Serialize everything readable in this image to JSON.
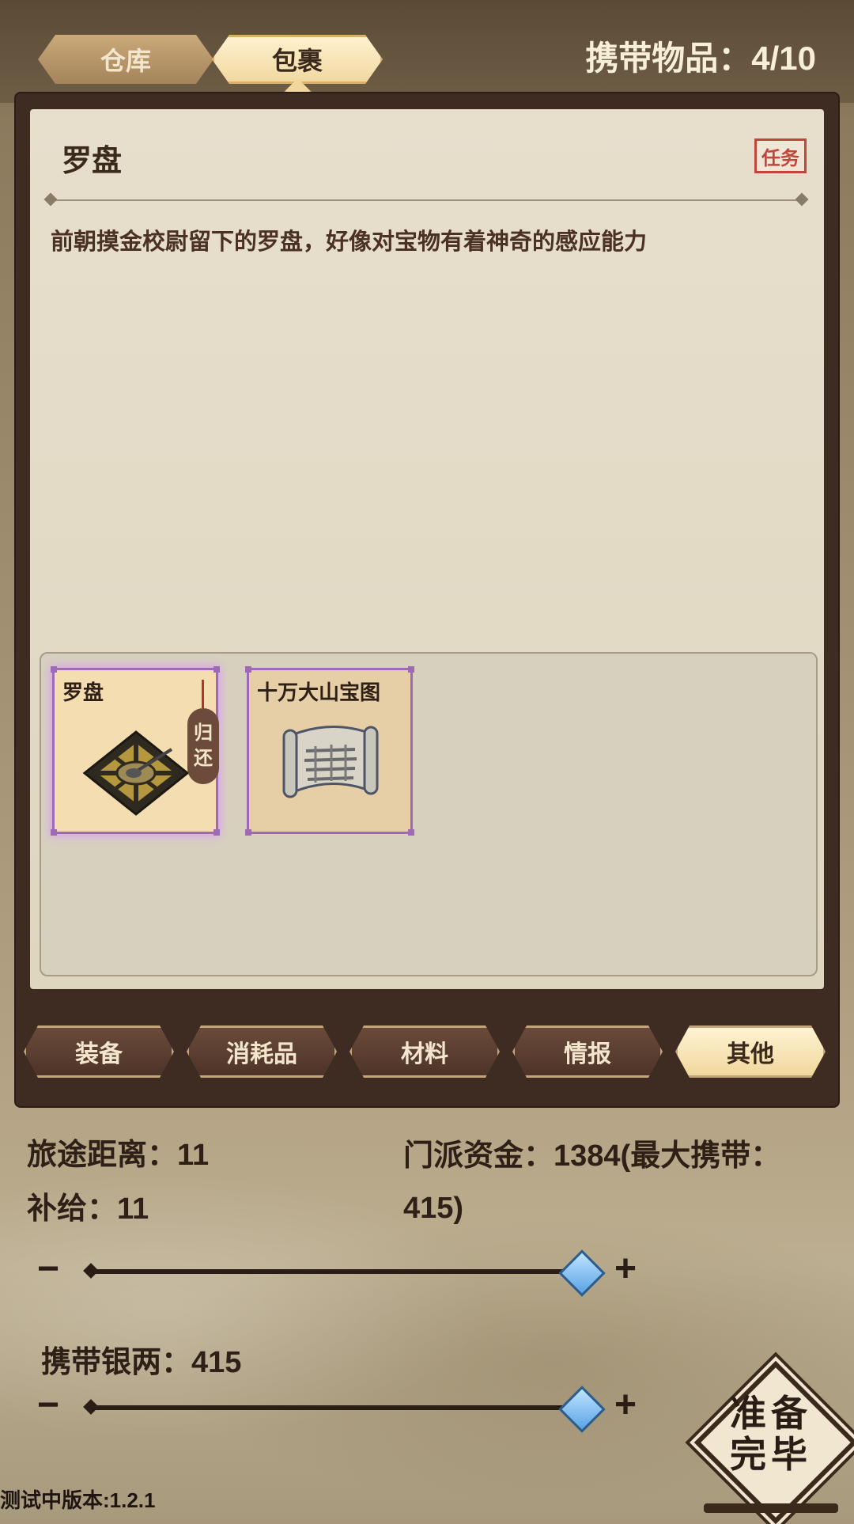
{
  "tabs": {
    "warehouse": "仓库",
    "pack": "包裹"
  },
  "carry_count": "携带物品：4/10",
  "detail": {
    "title": "罗盘",
    "badge": "任务",
    "description": "前朝摸金校尉留下的罗盘，好像对宝物有着神奇的感应能力"
  },
  "items": [
    {
      "label": "罗盘",
      "icon": "compass-icon",
      "selected": true,
      "return_tag": [
        "归",
        "还"
      ]
    },
    {
      "label": "十万大山宝图",
      "icon": "scroll-map-icon",
      "selected": false
    }
  ],
  "categories": [
    {
      "label": "装备",
      "active": false
    },
    {
      "label": "消耗品",
      "active": false
    },
    {
      "label": "材料",
      "active": false
    },
    {
      "label": "情报",
      "active": false
    },
    {
      "label": "其他",
      "active": true
    }
  ],
  "stats": {
    "distance": "旅途距离：11",
    "supply": "补给：11",
    "funds": "门派资金：1384(最大携带：415)"
  },
  "supply_slider": {
    "minus": "−",
    "plus": "+",
    "level": 1.0
  },
  "silver": {
    "label": "携带银两：415",
    "minus": "−",
    "plus": "+",
    "level": 1.0
  },
  "ready_button": {
    "line1": "准备",
    "line2": "完毕"
  },
  "version": "测试中版本:1.2.1",
  "colors": {
    "accent": "#f1d79e",
    "frame": "#3e2c22",
    "badge": "#c0453a",
    "slot_border": "#a069b5",
    "knob": "#5aa4e6"
  }
}
